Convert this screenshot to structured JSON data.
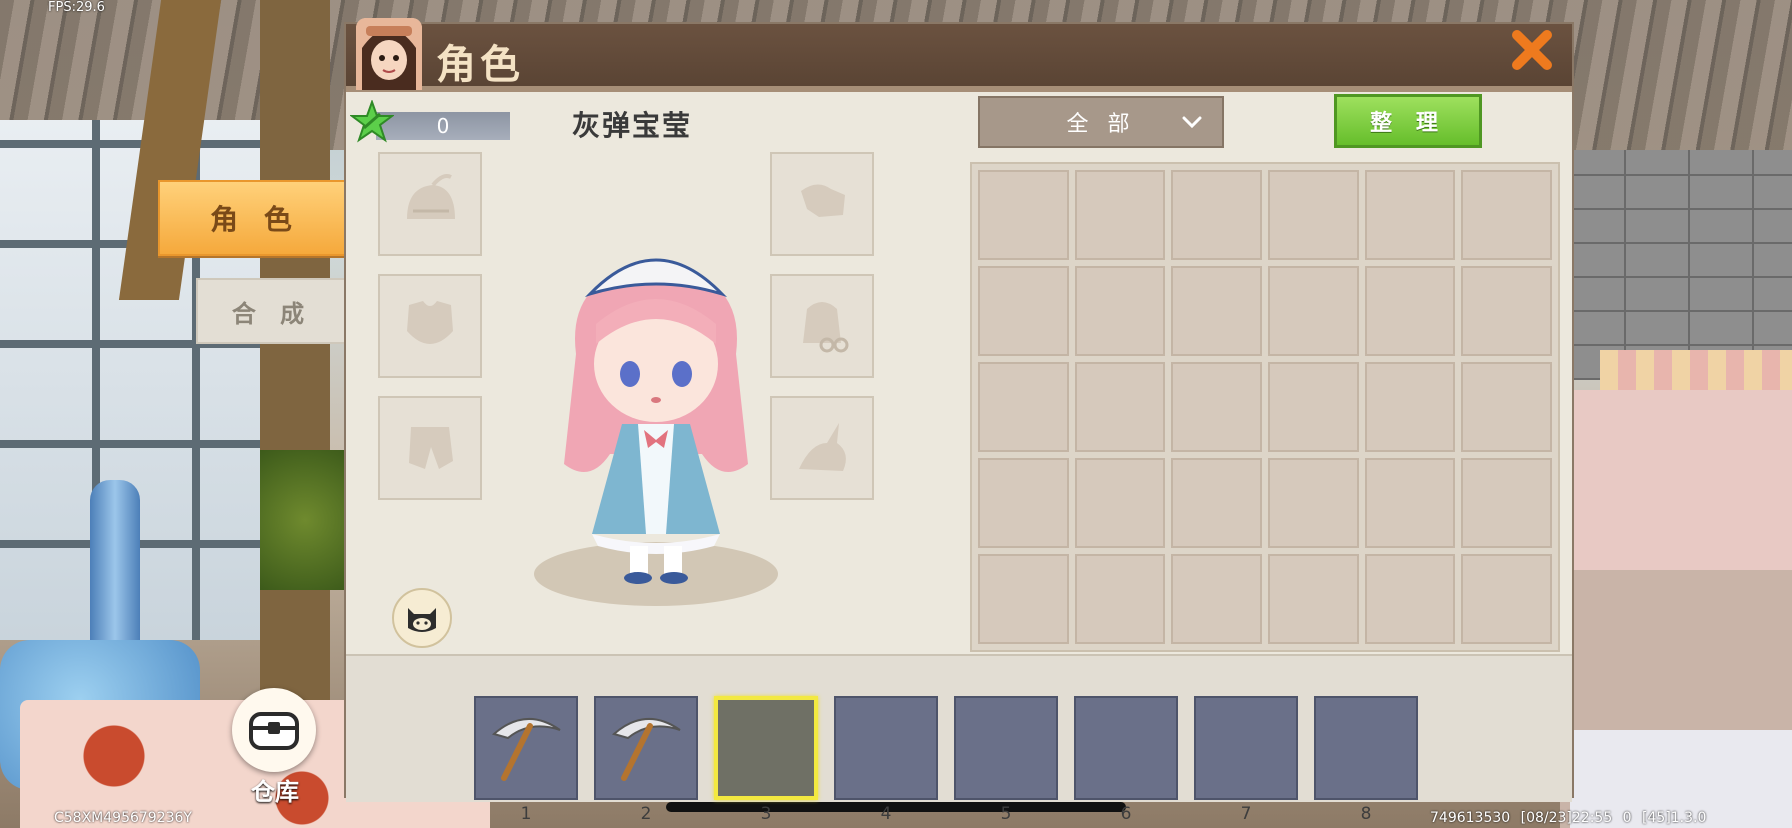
{
  "hud": {
    "fps": "FPS:29.6",
    "uid": "C58XM495679236Y",
    "status": "749613530 [08/23]22:55 0 [45]1.3.0"
  },
  "side_tabs": [
    {
      "label": "角 色",
      "active": true
    },
    {
      "label": "合 成",
      "active": false
    }
  ],
  "warehouse": {
    "label": "仓库",
    "icon": "chest-icon"
  },
  "panel": {
    "title": "角色",
    "score": "0",
    "character_name": "灰弹宝莹",
    "filter": {
      "selected": "全 部",
      "icon": "chevron-down-icon"
    },
    "sort_label": "整 理",
    "close_icon": "close-icon",
    "equip_slots": [
      {
        "name": "helmet-icon"
      },
      {
        "name": "chestplate-icon"
      },
      {
        "name": "leggings-icon"
      },
      {
        "name": "boots-icon"
      },
      {
        "name": "backpack-icon"
      },
      {
        "name": "dragon-icon"
      }
    ]
  },
  "inventory": {
    "rows": 5,
    "cols": 6,
    "filled": 0
  },
  "hotbar": [
    {
      "num": "1",
      "item": "pickaxe-icon"
    },
    {
      "num": "2",
      "item": "pickaxe-icon"
    },
    {
      "num": "3",
      "item": "",
      "selected": true
    },
    {
      "num": "4",
      "item": ""
    },
    {
      "num": "5",
      "item": ""
    },
    {
      "num": "6",
      "item": ""
    },
    {
      "num": "7",
      "item": ""
    },
    {
      "num": "8",
      "item": ""
    }
  ],
  "colors": {
    "accent_orange": "#f5a93c",
    "sort_green": "#66be2b",
    "title_brown": "#5a4434",
    "close_orange": "#ee7a1e",
    "hotbar_selected": "#f3e940"
  }
}
